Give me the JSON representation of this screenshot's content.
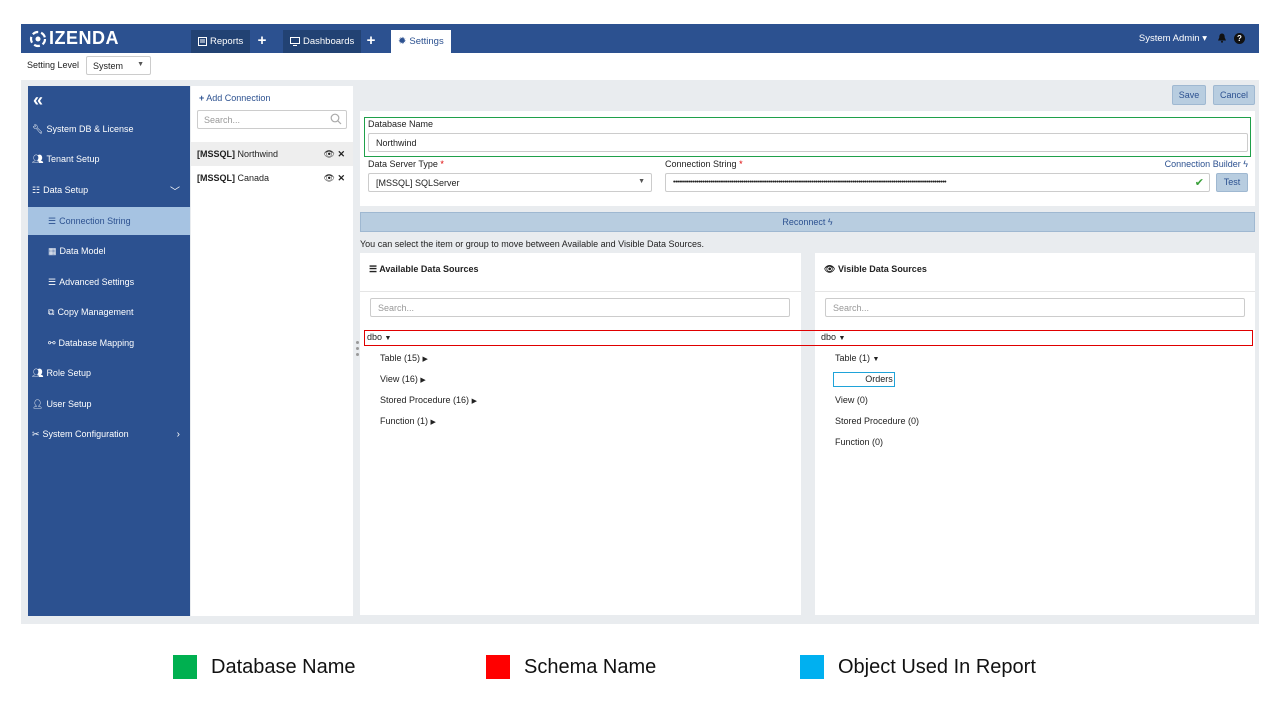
{
  "header": {
    "logo": "IZENDA",
    "tabs": [
      {
        "label": "Reports",
        "icon": "report-icon"
      },
      {
        "label": "Dashboards",
        "icon": "monitor-icon"
      },
      {
        "label": "Settings",
        "icon": "gear-icon"
      }
    ],
    "user": "System Admin ▾"
  },
  "setting_level": {
    "label": "Setting Level",
    "value": "System"
  },
  "sidebar": {
    "items": [
      {
        "label": "System DB & License",
        "icon": "wrench-icon"
      },
      {
        "label": "Tenant Setup",
        "icon": "users-icon"
      },
      {
        "label": "Data Setup",
        "icon": "data-setup-icon"
      },
      {
        "label": "Connection String",
        "icon": "connection-string-icon"
      },
      {
        "label": "Data Model",
        "icon": "grid-icon"
      },
      {
        "label": "Advanced Settings",
        "icon": "list-settings-icon"
      },
      {
        "label": "Copy Management",
        "icon": "copy-icon"
      },
      {
        "label": "Database Mapping",
        "icon": "mapping-icon"
      },
      {
        "label": "Role Setup",
        "icon": "users-icon"
      },
      {
        "label": "User Setup",
        "icon": "user-icon"
      },
      {
        "label": "System Configuration",
        "icon": "tools-icon"
      }
    ]
  },
  "connections": {
    "add_label": "Add Connection",
    "search_placeholder": "Search...",
    "items": [
      {
        "type": "[MSSQL]",
        "name": "Northwind"
      },
      {
        "type": "[MSSQL]",
        "name": "Canada"
      }
    ]
  },
  "toolbar": {
    "save_label": "Save",
    "cancel_label": "Cancel"
  },
  "form": {
    "db_name_label": "Database Name",
    "db_name_value": "Northwind",
    "server_type_label": "Data Server Type",
    "server_type_value": "[MSSQL] SQLServer",
    "conn_string_label": "Connection String",
    "conn_string_value": "••••••••••••••••••••••••••••••••••••••••••••••••••••••••••••••••••••••••••••••••••••••••••••••••••••••••••••••••••••••••••••••••••••••••••••",
    "conn_builder_label": "Connection Builder",
    "test_label": "Test",
    "reconnect_label": "Reconnect"
  },
  "hint": "You can select the item or group to move between Available and Visible Data Sources.",
  "available": {
    "title": "Available Data Sources",
    "search_placeholder": "Search...",
    "schema": "dbo",
    "groups": [
      "Table (15)",
      "View (16)",
      "Stored Procedure (16)",
      "Function (1)"
    ]
  },
  "visible": {
    "title": "Visible Data Sources",
    "search_placeholder": "Search...",
    "schema": "dbo",
    "groups": [
      "Table (1)",
      "View (0)",
      "Stored Procedure (0)",
      "Function (0)"
    ],
    "table_items": [
      "Orders"
    ]
  },
  "legend": [
    {
      "label": "Database Name",
      "color": "#00b050"
    },
    {
      "label": "Schema Name",
      "color": "#ff0000"
    },
    {
      "label": "Object Used In Report",
      "color": "#00b0f0"
    }
  ],
  "colors": {
    "header": "#2c5190",
    "active_nav": "#a6c3e2",
    "button": "#b8cde0"
  }
}
